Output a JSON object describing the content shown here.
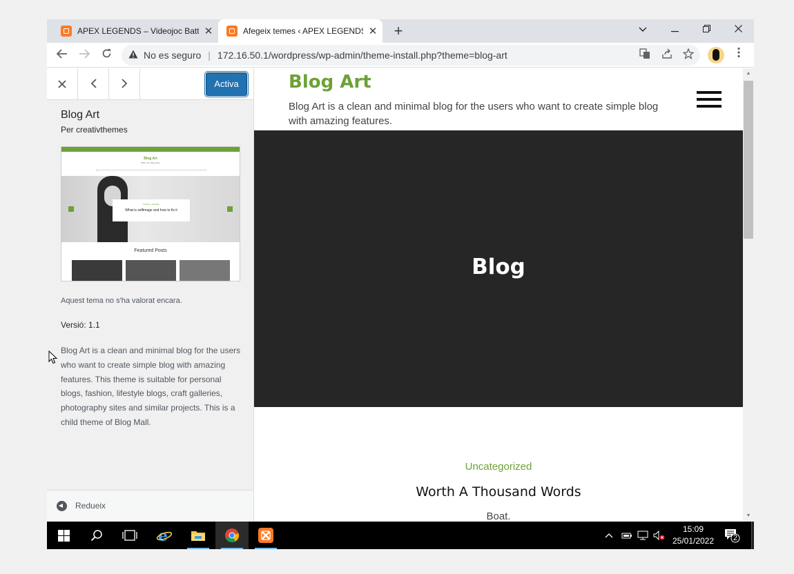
{
  "browser": {
    "tabs": [
      {
        "title": "APEX LEGENDS – Videojoc Battle",
        "active": false
      },
      {
        "title": "Afegeix temes ‹ APEX LEGENDS —",
        "active": true
      }
    ],
    "address": {
      "security_label": "No es seguro",
      "url": "172.16.50.1/wordpress/wp-admin/theme-install.php?theme=blog-art"
    }
  },
  "sidebar": {
    "activate_label": "Activa",
    "theme_name": "Blog Art",
    "author": "Per creativthemes",
    "screenshot": {
      "site_title": "Blog Art",
      "site_subtitle": "Write Your Blog Here",
      "slide_category": "Fashion, Lifestyle",
      "slide_title": "What is selfimage and how to fix it",
      "section_title": "Featured Posts"
    },
    "rating_text": "Aquest tema no s'ha valorat encara.",
    "version_text": "Versió: 1.1",
    "description": "Blog Art is a clean and minimal blog for the users who want to create simple blog with amazing features. This theme is suitable for personal blogs, fashion, lifestyle blogs, craft galleries, photography sites and similar projects. This is a child theme of Blog Mall.",
    "collapse_label": "Redueix"
  },
  "preview": {
    "site_title": "Blog Art",
    "site_description": "Blog Art is a clean and minimal blog for the users who want to create simple blog with amazing features.",
    "banner_title": "Blog",
    "post": {
      "category": "Uncategorized",
      "title": "Worth A Thousand Words",
      "excerpt": "Boat."
    }
  },
  "taskbar": {
    "time": "15:09",
    "date": "25/01/2022",
    "notification_count": "2"
  },
  "colors": {
    "accent_green": "#6ca236",
    "wp_blue": "#2271b1",
    "banner_dark": "#262626"
  }
}
